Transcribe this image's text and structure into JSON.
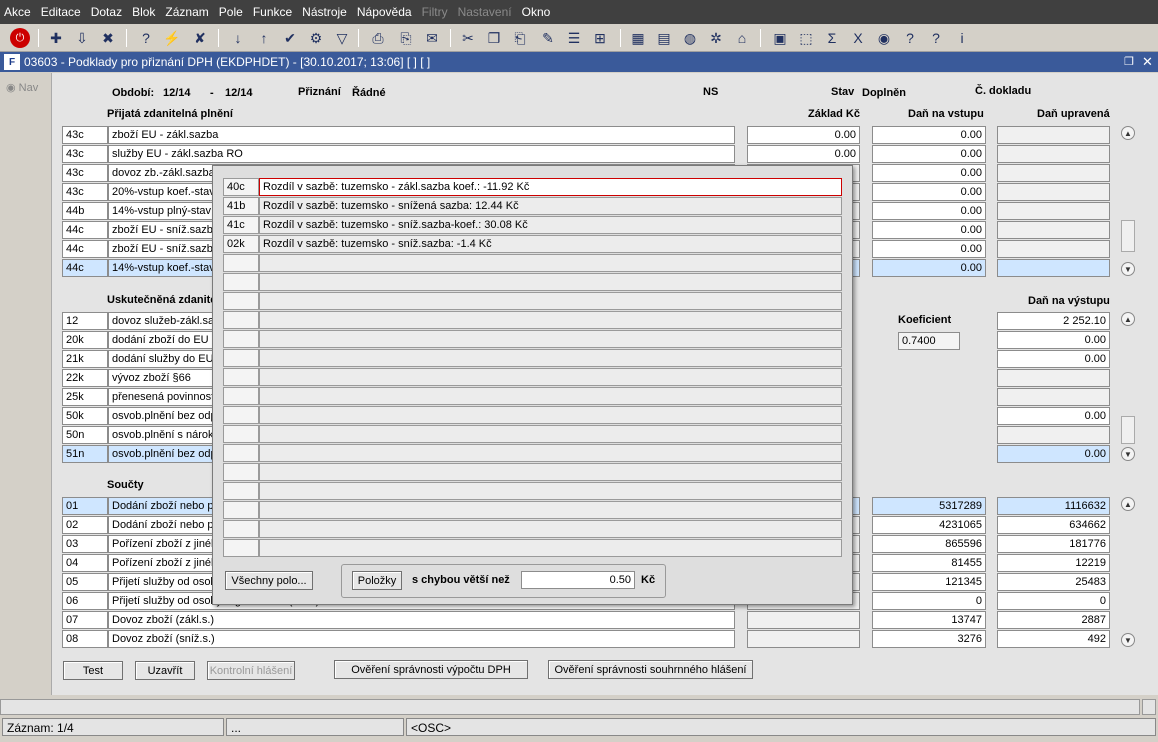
{
  "menu": [
    "Akce",
    "Editace",
    "Dotaz",
    "Blok",
    "Záznam",
    "Pole",
    "Funkce",
    "Nástroje",
    "Nápověda",
    "Filtry",
    "Nastavení",
    "Okno"
  ],
  "menu_disabled": [
    "Filtry",
    "Nastavení"
  ],
  "window_title": "03603 - Podklady pro přiznání DPH (EKDPHDET) - [30.10.2017; 13:06]  [ ]  [ ]",
  "left_nav": "Nav",
  "header": {
    "obdobi_label": "Období:",
    "obdobi_from": "12/14",
    "dash": "-",
    "obdobi_to": "12/14",
    "priznani_label": "Přiznání",
    "priznani_value": "Řádné",
    "ns_label": "NS",
    "stav_label": "Stav",
    "stav_value": "Doplněn",
    "doklad_label": "Č. dokladu"
  },
  "sec1": {
    "title": "Přijatá zdanitelná plnění",
    "col_zaklad": "Základ Kč",
    "col_dan_vstup": "Daň na vstupu",
    "col_dan_upr": "Daň upravená",
    "rows": [
      {
        "code": "43c",
        "desc": "zboží EU - zákl.sazba",
        "zaklad": "0.00",
        "dan": "0.00",
        "upr": ""
      },
      {
        "code": "43c",
        "desc": "služby EU - zákl.sazba RO",
        "zaklad": "0.00",
        "dan": "0.00",
        "upr": ""
      },
      {
        "code": "43c",
        "desc": "dovoz zb.-zákl.sazba",
        "zaklad": "",
        "dan": "0.00",
        "upr": ""
      },
      {
        "code": "43c",
        "desc": "20%-vstup koef.-stav",
        "zaklad": "",
        "dan": "0.00",
        "upr": ""
      },
      {
        "code": "44b",
        "desc": "14%-vstup plný-stav",
        "zaklad": "",
        "dan": "0.00",
        "upr": ""
      },
      {
        "code": "44c",
        "desc": "zboží EU - sníž.sazba",
        "zaklad": "",
        "dan": "0.00",
        "upr": ""
      },
      {
        "code": "44c",
        "desc": "zboží EU - sníž.sazba",
        "zaklad": "",
        "dan": "0.00",
        "upr": ""
      },
      {
        "code": "44c",
        "desc": "14%-vstup koef.-stav",
        "zaklad": "",
        "dan": "0.00",
        "upr": ""
      }
    ]
  },
  "sec2": {
    "title": "Uskutečněná zdanitelná plnění",
    "col_dan_vystup": "Daň na výstupu",
    "koef_label": "Koeficient",
    "koef_value": "0.7400",
    "rows": [
      {
        "code": "12",
        "desc": "dovoz služeb-zákl.sazba",
        "zaklad": "",
        "dan": "2 252.10"
      },
      {
        "code": "20k",
        "desc": "dodání zboží do EU",
        "zaklad": "",
        "dan": "0.00"
      },
      {
        "code": "21k",
        "desc": "dodání služby do EU",
        "zaklad": "",
        "dan": "0.00"
      },
      {
        "code": "22k",
        "desc": "vývoz zboží §66",
        "zaklad": "",
        "dan": ""
      },
      {
        "code": "25k",
        "desc": "přenesená povinnost",
        "zaklad": "",
        "dan": ""
      },
      {
        "code": "50k",
        "desc": "osvob.plnění bez odpočtu",
        "zaklad": "",
        "dan": "0.00"
      },
      {
        "code": "50n",
        "desc": "osvob.plnění s nárokem",
        "zaklad": "",
        "dan": ""
      },
      {
        "code": "51n",
        "desc": "osvob.plnění bez odpočtu",
        "zaklad": "",
        "dan": "0.00"
      }
    ]
  },
  "sec3": {
    "title": "Součty",
    "rows": [
      {
        "code": "01",
        "desc": "Dodání zboží nebo poskytnutí služeb",
        "a": "5317289",
        "b": "1116632"
      },
      {
        "code": "02",
        "desc": "Dodání zboží nebo poskytnutí služeb",
        "a": "4231065",
        "b": "634662"
      },
      {
        "code": "03",
        "desc": "Pořízení zboží z jiného členského státu",
        "a": "865596",
        "b": "181776"
      },
      {
        "code": "04",
        "desc": "Pořízení zboží z jiného členského státu",
        "a": "81455",
        "b": "12219"
      },
      {
        "code": "05",
        "desc": "Přijetí služby od osoby registrované",
        "a": "121345",
        "b": "25483"
      },
      {
        "code": "06",
        "desc": "Přijetí služby od osoby registrované (sníž.)",
        "a": "0",
        "b": "0"
      },
      {
        "code": "07",
        "desc": "Dovoz zboží (zákl.s.)",
        "a": "13747",
        "b": "2887"
      },
      {
        "code": "08",
        "desc": "Dovoz zboží (sníž.s.)",
        "a": "3276",
        "b": "492"
      }
    ]
  },
  "popup": {
    "rows": [
      {
        "code": "40c",
        "text": "Rozdíl v sazbě: tuzemsko - zákl.sazba koef.: -11.92 Kč"
      },
      {
        "code": "41b",
        "text": "Rozdíl v sazbě: tuzemsko - snížená sazba: 12.44 Kč"
      },
      {
        "code": "41c",
        "text": "Rozdíl v sazbě: tuzemsko - sníž.sazba-koef.: 30.08 Kč"
      },
      {
        "code": "02k",
        "text": "Rozdíl v sazbě: tuzemsko - sníž.sazba: -1.4 Kč"
      }
    ],
    "btn_all": "Všechny polo...",
    "btn_items": "Položky",
    "error_label": "s chybou větší než",
    "error_value": "0.50",
    "currency": "Kč"
  },
  "buttons": {
    "test": "Test",
    "close": "Uzavřít",
    "control": "Kontrolní hlášení",
    "verify_vat": "Ověření správnosti výpočtu DPH",
    "verify_summary": "Ověření správnosti souhrnného hlášení"
  },
  "status": {
    "record": "Záznam: 1/4",
    "dots": "...",
    "osc": "<OSC>"
  }
}
